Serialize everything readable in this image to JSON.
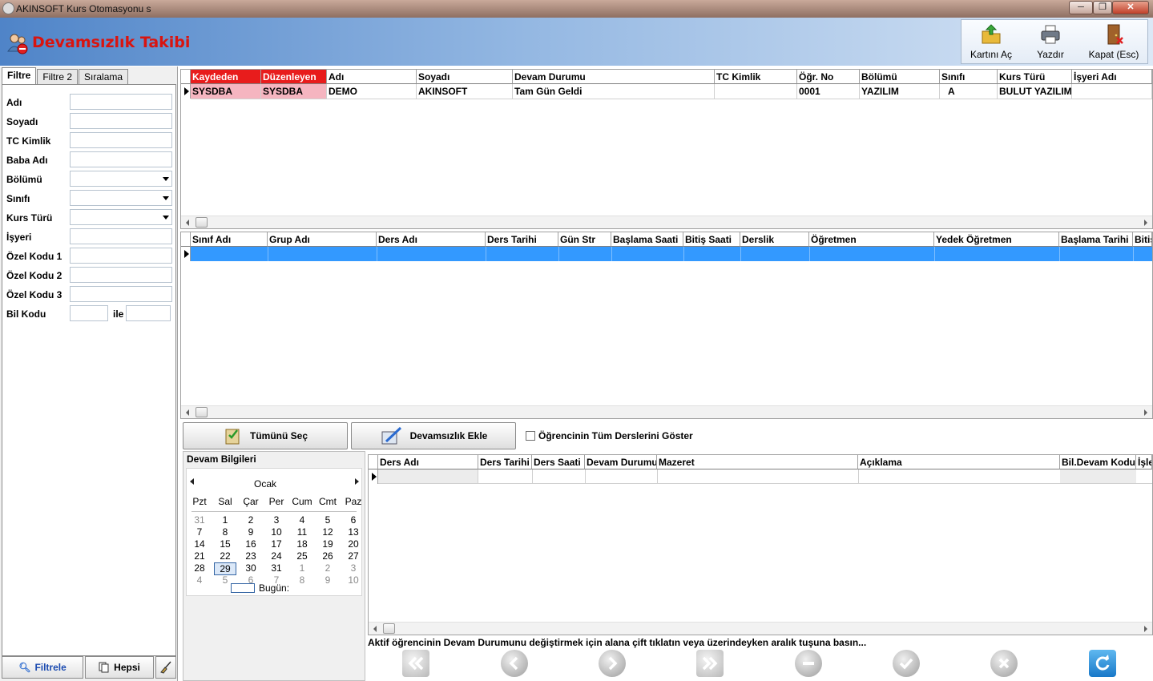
{
  "window": {
    "title": "AKINSOFT Kurs Otomasyonu s",
    "btn_min": "─",
    "btn_max": "❐",
    "btn_close": "✕"
  },
  "header": {
    "title": "Devamsızlık Takibi"
  },
  "toolbar": {
    "open_card": "Kartını Aç",
    "print": "Yazdır",
    "close": "Kapat (Esc)"
  },
  "filter": {
    "tabs": [
      "Filtre",
      "Filtre 2",
      "Sıralama"
    ],
    "fields": {
      "name": "Adı",
      "surname": "Soyadı",
      "tc": "TC Kimlik",
      "father": "Baba Adı",
      "department": "Bölümü",
      "class": "Sınıfı",
      "course_type": "Kurs Türü",
      "workplace": "İşyeri",
      "special1": "Özel Kodu 1",
      "special2": "Özel Kodu 2",
      "special3": "Özel Kodu 3",
      "bil_code": "Bil Kodu",
      "bil_and": "ile"
    },
    "btn_filter": "Filtrele",
    "btn_all": "Hepsi"
  },
  "students_grid": {
    "headers": [
      "Kaydeden",
      "Düzenleyen",
      "Adı",
      "Soyadı",
      "Devam Durumu",
      "TC Kimlik",
      "Öğr. No",
      "Bölümü",
      "Sınıfı",
      "Kurs Türü",
      "İşyeri Adı"
    ],
    "row": [
      "SYSDBA",
      "SYSDBA",
      "DEMO",
      "AKINSOFT",
      "Tam Gün Geldi",
      "",
      "0001",
      "YAZILIM",
      "A",
      "BULUT YAZILIM",
      ""
    ]
  },
  "lessons_grid": {
    "headers": [
      "Sınıf Adı",
      "Grup Adı",
      "Ders Adı",
      "Ders Tarihi",
      "Gün Str",
      "Başlama Saati",
      "Bitiş Saati",
      "Derslik",
      "Öğretmen",
      "Yedek Öğretmen",
      "Başlama Tarihi",
      "Bitiş"
    ]
  },
  "actions": {
    "select_all": "Tümünü Seç",
    "add_absence": "Devamsızlık Ekle",
    "show_all_lessons": "Öğrencinin Tüm Derslerini Göster"
  },
  "calendar": {
    "panel_title": "Devam Bilgileri",
    "month": "Ocak",
    "weekdays": [
      "Pzt",
      "Sal",
      "Çar",
      "Per",
      "Cum",
      "Cmt",
      "Paz"
    ],
    "weeks": [
      [
        "31",
        "1",
        "2",
        "3",
        "4",
        "5",
        "6"
      ],
      [
        "7",
        "8",
        "9",
        "10",
        "11",
        "12",
        "13"
      ],
      [
        "14",
        "15",
        "16",
        "17",
        "18",
        "19",
        "20"
      ],
      [
        "21",
        "22",
        "23",
        "24",
        "25",
        "26",
        "27"
      ],
      [
        "28",
        "29",
        "30",
        "31",
        "1",
        "2",
        "3"
      ],
      [
        "4",
        "5",
        "6",
        "7",
        "8",
        "9",
        "10"
      ]
    ],
    "today_label": "Bugün:",
    "selected_day": "29"
  },
  "attendance_grid": {
    "headers": [
      "Ders Adı",
      "Ders Tarihi",
      "Ders Saati",
      "Devam Durumu",
      "Mazeret",
      "Açıklama",
      "Bil.Devam Kodu",
      "İşle"
    ]
  },
  "status_hint": "Aktif öğrencinin Devam Durumunu değiştirmek için alana çift tıklatın veya üzerindeyken aralık tuşuna basın...",
  "colors": {
    "selected_row": "#3399ff",
    "audit_header": "#e81c1c",
    "audit_cell": "#f5b5c0",
    "title_red": "#d9140f"
  }
}
